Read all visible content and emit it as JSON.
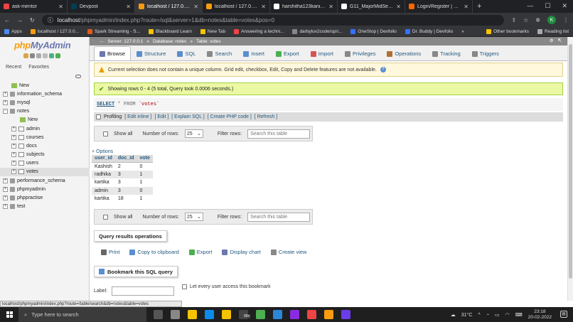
{
  "browser": {
    "tabs": [
      {
        "title": "ask-mentor",
        "color": "#e44"
      },
      {
        "title": "Devpost",
        "color": "#003e54"
      },
      {
        "title": "localhost / 127.0.0.1",
        "color": "#f89c0e"
      },
      {
        "title": "localhost / 127.0.0.1",
        "color": "#f89c0e"
      },
      {
        "title": "harshitha123kanikam",
        "color": "#fff"
      },
      {
        "title": "G11_MajorMidSemP",
        "color": "#fff"
      },
      {
        "title": "Login/Register | Notes",
        "color": "#f60"
      }
    ],
    "new_tab": "+",
    "url_host": "localhost",
    "url_path": "/phpmyadmin/index.php?route=/sql&server=1&db=notes&table=votes&pos=0",
    "profile_initial": "K",
    "bookmarks": [
      {
        "label": "Apps",
        "color": "#4a8af4"
      },
      {
        "label": "localhost / 127.0.0...",
        "color": "#f89c0e"
      },
      {
        "label": "Spark Streaming - S...",
        "color": "#e25a1c"
      },
      {
        "label": "Blackboard Learn",
        "color": "#f5c400"
      },
      {
        "label": "New Tab",
        "color": "#f5c400"
      },
      {
        "label": "Answering a techni...",
        "color": "#e44"
      },
      {
        "label": "darbyluv2code/spri...",
        "color": "#888"
      },
      {
        "label": "OneStop | Devfolio",
        "color": "#3770ff"
      },
      {
        "label": "Dr. Buddy | Devfolio",
        "color": "#3770ff"
      },
      {
        "label": "»",
        "color": ""
      },
      {
        "label": "Other bookmarks",
        "color": "#f5c400"
      },
      {
        "label": "Reading list",
        "color": "#aaa"
      }
    ]
  },
  "sidebar": {
    "logo_php": "php",
    "logo_myadmin": "MyAdmin",
    "recent": "Recent",
    "favorites": "Favorites",
    "tree": [
      {
        "label": "New",
        "type": "new",
        "level": 1
      },
      {
        "label": "information_schema",
        "type": "db",
        "level": 0
      },
      {
        "label": "mysql",
        "type": "db",
        "level": 0
      },
      {
        "label": "notes",
        "type": "db",
        "level": 0,
        "expanded": true
      },
      {
        "label": "New",
        "type": "new",
        "level": 2
      },
      {
        "label": "admin",
        "type": "table",
        "level": 1
      },
      {
        "label": "courses",
        "type": "table",
        "level": 1
      },
      {
        "label": "docs",
        "type": "table",
        "level": 1
      },
      {
        "label": "subjects",
        "type": "table",
        "level": 1
      },
      {
        "label": "users",
        "type": "table",
        "level": 1
      },
      {
        "label": "votes",
        "type": "table",
        "level": 1,
        "selected": true
      },
      {
        "label": "performance_schema",
        "type": "db",
        "level": 0
      },
      {
        "label": "phpmyadmin",
        "type": "db",
        "level": 0
      },
      {
        "label": "phppractise",
        "type": "db",
        "level": 0
      },
      {
        "label": "test",
        "type": "db",
        "level": 0
      }
    ]
  },
  "breadcrumb": {
    "server": "Server: 127.0.0.1",
    "database": "Database: notes",
    "table": "Table: votes"
  },
  "tabs": [
    {
      "label": "Browse",
      "color": "#6c78af",
      "active": true
    },
    {
      "label": "Structure",
      "color": "#5a8ed0"
    },
    {
      "label": "SQL",
      "color": "#5a8ed0"
    },
    {
      "label": "Search",
      "color": "#888"
    },
    {
      "label": "Insert",
      "color": "#5a8ed0"
    },
    {
      "label": "Export",
      "color": "#4caf50"
    },
    {
      "label": "Import",
      "color": "#d9534f"
    },
    {
      "label": "Privileges",
      "color": "#888"
    },
    {
      "label": "Operations",
      "color": "#b07030"
    },
    {
      "label": "Tracking",
      "color": "#888"
    },
    {
      "label": "Triggers",
      "color": "#888"
    }
  ],
  "notice": "Current selection does not contain a unique column. Grid edit, checkbox, Edit, Copy and Delete features are not available.",
  "success": "Showing rows 0 - 4 (5 total, Query took 0.0006 seconds.)",
  "sql": {
    "select": "SELECT",
    "rest": " * FROM ",
    "table": "`votes`"
  },
  "profiling": {
    "label": "Profiling",
    "links": [
      "[ Edit inline ]",
      "[ Edit ]",
      "[ Explain SQL ]",
      "[ Create PHP code ]",
      "[ Refresh ]"
    ]
  },
  "nav": {
    "show_all": "Show all",
    "rows_label": "Number of rows:",
    "rows_value": "25",
    "filter_label": "Filter rows:",
    "filter_placeholder": "Search this table"
  },
  "options_link": "+ Options",
  "table": {
    "columns": [
      "user_id",
      "doc_id",
      "vote"
    ],
    "rows": [
      [
        "Kashish",
        "2",
        "0"
      ],
      [
        "radhika",
        "3",
        "1"
      ],
      [
        "kartika",
        "3",
        "1"
      ],
      [
        "admin",
        "3",
        "0"
      ],
      [
        "kartika",
        "18",
        "1"
      ]
    ]
  },
  "query_ops": {
    "title": "Query results operations",
    "items": [
      {
        "label": "Print",
        "color": "#666"
      },
      {
        "label": "Copy to clipboard",
        "color": "#5a8ed0"
      },
      {
        "label": "Export",
        "color": "#4caf50"
      },
      {
        "label": "Display chart",
        "color": "#6c78af"
      },
      {
        "label": "Create view",
        "color": "#888"
      }
    ]
  },
  "bookmark": {
    "title": "Bookmark this SQL query",
    "label": "Label:",
    "every_user": "Let every user access this bookmark"
  },
  "status_url": "localhost/phpmyadmin/index.php?route=/table/search&db=notes&table=votes",
  "taskbar": {
    "search_placeholder": "Type here to search",
    "temperature": "31°C",
    "time": "23:18",
    "date": "20-02-2022",
    "badge": "99+",
    "apps": [
      "#555",
      "#888",
      "#f5c400",
      "#0c8ce9",
      "#f5c400",
      "#444",
      "#4caf50",
      "#2b88d8",
      "#8a2be2",
      "#e44",
      "#f89c0e",
      "#6a3de8"
    ]
  }
}
